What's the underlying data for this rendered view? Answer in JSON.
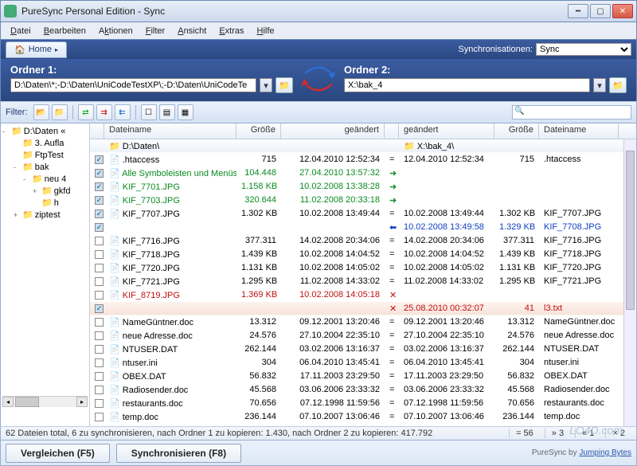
{
  "window": {
    "title": "PureSync Personal Edition  -  Sync"
  },
  "menu": {
    "datei": "Datei",
    "bearbeiten": "Bearbeiten",
    "aktionen": "Aktionen",
    "filter": "Filter",
    "ansicht": "Ansicht",
    "extras": "Extras",
    "hilfe": "Hilfe"
  },
  "tabs": {
    "home": "Home"
  },
  "syncselect": {
    "label": "Synchronisationen:",
    "value": "Sync"
  },
  "folders": {
    "label1": "Ordner 1:",
    "path1": "D:\\Daten\\*;-D:\\Daten\\UniCodeTestXP\\;-D:\\Daten\\UniCodeTe",
    "label2": "Ordner 2:",
    "path2": "X:\\bak_4"
  },
  "toolbar": {
    "filter": "Filter:"
  },
  "tree": [
    {
      "l": 0,
      "exp": "-",
      "label": "D:\\Daten «"
    },
    {
      "l": 1,
      "exp": "",
      "label": "3. Aufla"
    },
    {
      "l": 1,
      "exp": "",
      "label": "FtpTest"
    },
    {
      "l": 1,
      "exp": "-",
      "label": "bak"
    },
    {
      "l": 2,
      "exp": "-",
      "label": "neu 4"
    },
    {
      "l": 3,
      "exp": "+",
      "label": "gkfd"
    },
    {
      "l": 3,
      "exp": "",
      "label": "h"
    },
    {
      "l": 1,
      "exp": "+",
      "label": "ziptest"
    }
  ],
  "headers": {
    "name1": "Dateiname",
    "size1": "Größe",
    "date1": "geändert",
    "date2": "geändert",
    "size2": "Größe",
    "name2": "Dateiname"
  },
  "paths": {
    "left": "D:\\Daten\\",
    "right": "X:\\bak_4\\"
  },
  "rows": [
    {
      "chk": true,
      "name1": ".htaccess",
      "size1": "715",
      "date1": "12.04.2010 12:52:34",
      "dir": "=",
      "date2": "12.04.2010 12:52:34",
      "size2": "715",
      "name2": ".htaccess"
    },
    {
      "chk": true,
      "c": "green",
      "name1": "Alle Symboleisten und Menüs.c",
      "size1": "104.448",
      "date1": "27.04.2010 13:57:32",
      "dir": "→"
    },
    {
      "chk": true,
      "c": "green",
      "name1": "KIF_7701.JPG",
      "size1": "1.158 KB",
      "date1": "10.02.2008 13:38:28",
      "dir": "→"
    },
    {
      "chk": true,
      "c": "green",
      "name1": "KIF_7703.JPG",
      "size1": "320.644",
      "date1": "11.02.2008 20:33:18",
      "dir": "→"
    },
    {
      "chk": true,
      "name1": "KIF_7707.JPG",
      "size1": "1.302 KB",
      "date1": "10.02.2008 13:49:44",
      "dir": "=",
      "date2": "10.02.2008 13:49:44",
      "size2": "1.302 KB",
      "name2": "KIF_7707.JPG"
    },
    {
      "chk": true,
      "c": "blue",
      "dir": "←",
      "date2": "10.02.2008 13:49:58",
      "size2": "1.329 KB",
      "name2": "KIF_7708.JPG"
    },
    {
      "chk": false,
      "name1": "KIF_7716.JPG",
      "size1": "377.311",
      "date1": "14.02.2008 20:34:06",
      "dir": "=",
      "date2": "14.02.2008 20:34:06",
      "size2": "377.311",
      "name2": "KIF_7716.JPG"
    },
    {
      "chk": false,
      "name1": "KIF_7718.JPG",
      "size1": "1.439 KB",
      "date1": "10.02.2008 14:04:52",
      "dir": "=",
      "date2": "10.02.2008 14:04:52",
      "size2": "1.439 KB",
      "name2": "KIF_7718.JPG"
    },
    {
      "chk": false,
      "name1": "KIF_7720.JPG",
      "size1": "1.131 KB",
      "date1": "10.02.2008 14:05:02",
      "dir": "=",
      "date2": "10.02.2008 14:05:02",
      "size2": "1.131 KB",
      "name2": "KIF_7720.JPG"
    },
    {
      "chk": false,
      "name1": "KIF_7721.JPG",
      "size1": "1.295 KB",
      "date1": "11.02.2008 14:33:02",
      "dir": "=",
      "date2": "11.02.2008 14:33:02",
      "size2": "1.295 KB",
      "name2": "KIF_7721.JPG"
    },
    {
      "chk": false,
      "c": "red",
      "name1": "KIF_8719.JPG",
      "size1": "1.369 KB",
      "date1": "10.02.2008 14:05:18",
      "dir": "✕"
    },
    {
      "chk": true,
      "c": "red",
      "sel": true,
      "dir": "✕",
      "date2": "25.08.2010 00:32:07",
      "size2": "41",
      "name2": "l3.txt"
    },
    {
      "chk": false,
      "name1": "NameGüntner.doc",
      "size1": "13.312",
      "date1": "09.12.2001 13:20:46",
      "dir": "=",
      "date2": "09.12.2001 13:20:46",
      "size2": "13.312",
      "name2": "NameGüntner.doc"
    },
    {
      "chk": false,
      "name1": "neue Adresse.doc",
      "size1": "24.576",
      "date1": "27.10.2004 22:35:10",
      "dir": "=",
      "date2": "27.10.2004 22:35:10",
      "size2": "24.576",
      "name2": "neue Adresse.doc"
    },
    {
      "chk": false,
      "name1": "NTUSER.DAT",
      "size1": "262.144",
      "date1": "03.02.2006 13:16:37",
      "dir": "=",
      "date2": "03.02.2006 13:16:37",
      "size2": "262.144",
      "name2": "NTUSER.DAT"
    },
    {
      "chk": false,
      "name1": "ntuser.ini",
      "size1": "304",
      "date1": "06.04.2010 13:45:41",
      "dir": "=",
      "date2": "06.04.2010 13:45:41",
      "size2": "304",
      "name2": "ntuser.ini"
    },
    {
      "chk": false,
      "name1": "OBEX.DAT",
      "size1": "56.832",
      "date1": "17.11.2003 23:29:50",
      "dir": "=",
      "date2": "17.11.2003 23:29:50",
      "size2": "56.832",
      "name2": "OBEX.DAT"
    },
    {
      "chk": false,
      "name1": "Radiosender.doc",
      "size1": "45.568",
      "date1": "03.06.2006 23:33:32",
      "dir": "=",
      "date2": "03.06.2006 23:33:32",
      "size2": "45.568",
      "name2": "Radiosender.doc"
    },
    {
      "chk": false,
      "name1": "restaurants.doc",
      "size1": "70.656",
      "date1": "07.12.1998 11:59:56",
      "dir": "=",
      "date2": "07.12.1998 11:59:56",
      "size2": "70.656",
      "name2": "restaurants.doc"
    },
    {
      "chk": false,
      "name1": "temp.doc",
      "size1": "236.144",
      "date1": "07.10.2007 13:06:46",
      "dir": "=",
      "date2": "07.10.2007 13:06:46",
      "size2": "236.144",
      "name2": "temp.doc"
    }
  ],
  "status": {
    "text": "62 Dateien total,  6 zu synchronisieren,  nach Ordner 1 zu kopieren: 1.430,  nach Ordner 2 zu kopieren: 417.792",
    "eq": "= 56",
    "r": "» 3",
    "l": "« 1",
    "x": "× 2"
  },
  "buttons": {
    "compare": "Vergleichen (F5)",
    "sync": "Synchronisieren (F8)"
  },
  "credit": {
    "prefix": "PureSync by ",
    "link": "Jumping Bytes"
  },
  "watermark": "LO4D.com"
}
